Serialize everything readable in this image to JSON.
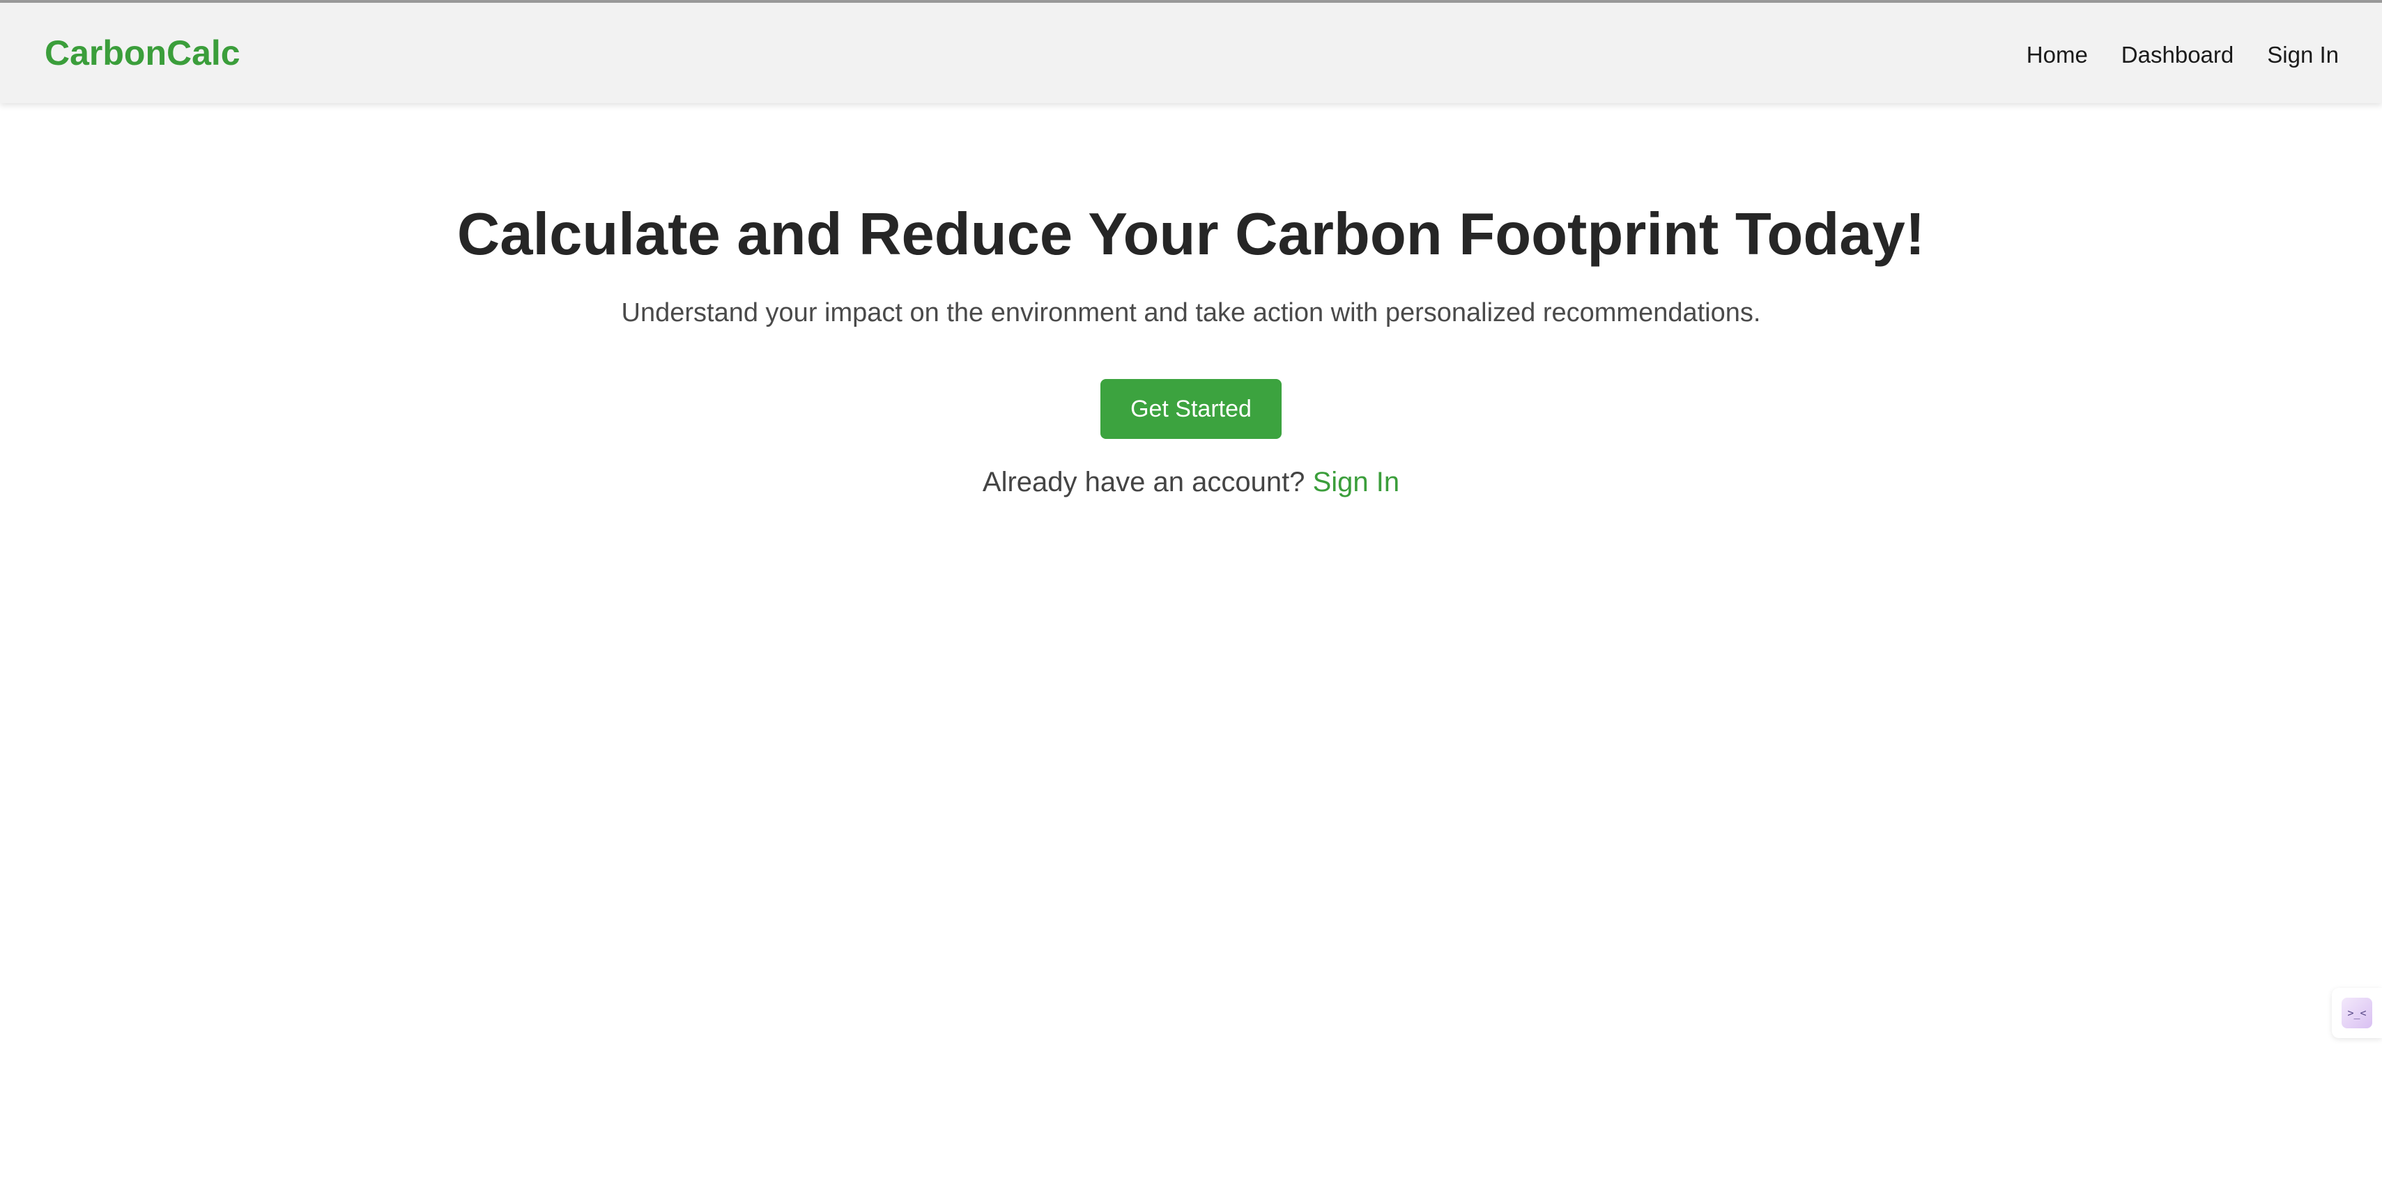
{
  "header": {
    "brand": "CarbonCalc",
    "nav": [
      {
        "label": "Home"
      },
      {
        "label": "Dashboard"
      },
      {
        "label": "Sign In"
      }
    ]
  },
  "hero": {
    "title": "Calculate and Reduce Your Carbon Footprint Today!",
    "subtitle": "Understand your impact on the environment and take action with personalized recommendations.",
    "cta_label": "Get Started",
    "signin_prompt": "Already have an account?",
    "signin_link": "Sign In"
  },
  "widget": {
    "icon": "assistant-face-icon",
    "glyph": ">_<"
  },
  "colors": {
    "accent": "#3b9e3b",
    "button": "#3ca33f",
    "navbar_bg": "#f2f2f2",
    "title_text": "#262626"
  }
}
